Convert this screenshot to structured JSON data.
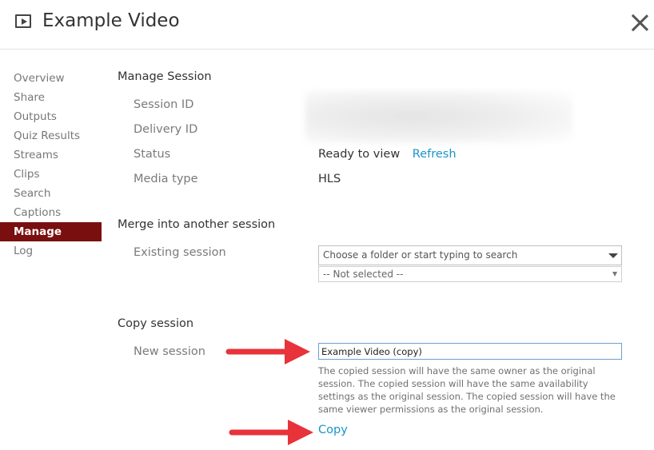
{
  "header": {
    "title": "Example Video",
    "video_icon": "video-play-icon",
    "close_icon": "close-icon"
  },
  "sidebar": {
    "items": [
      {
        "label": "Overview"
      },
      {
        "label": "Share"
      },
      {
        "label": "Outputs"
      },
      {
        "label": "Quiz Results"
      },
      {
        "label": "Streams"
      },
      {
        "label": "Clips"
      },
      {
        "label": "Search"
      },
      {
        "label": "Captions"
      },
      {
        "label": "Manage"
      },
      {
        "label": "Log"
      }
    ],
    "active": "Manage",
    "active_color": "#7a0f0f"
  },
  "manage_session": {
    "title": "Manage Session",
    "session_id_label": "Session ID",
    "delivery_id_label": "Delivery ID",
    "status_label": "Status",
    "status_value": "Ready to view",
    "refresh_link": "Refresh",
    "media_type_label": "Media type",
    "media_type_value": "HLS"
  },
  "merge_session": {
    "title": "Merge into another session",
    "existing_label": "Existing session",
    "folder_placeholder": "Choose a folder or start typing to search",
    "session_select_value": "-- Not selected --"
  },
  "copy_session": {
    "title": "Copy session",
    "new_session_label": "New session",
    "new_session_value": "Example Video (copy)",
    "help_text": "The copied session will have the same owner as the original session. The copied session will have the same availability settings as the original session. The copied session will have the same viewer permissions as the original session.",
    "copy_link": "Copy"
  },
  "colors": {
    "link": "#1a94c8",
    "annotation_arrow": "#e8333a",
    "input_border": "#6e9fd0"
  }
}
